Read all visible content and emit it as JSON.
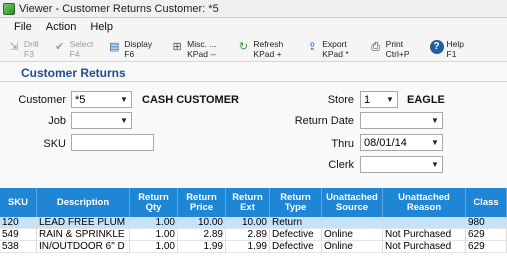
{
  "window": {
    "title": "Viewer - Customer Returns  Customer: *5"
  },
  "menu": [
    "File",
    "Action",
    "Help"
  ],
  "toolbar": [
    {
      "line1": "Drill",
      "line2": "F3",
      "icon": "drill-icon",
      "glyph": "⇲",
      "color": "#9a9a9a",
      "disabled": true
    },
    {
      "line1": "Select",
      "line2": "F4",
      "icon": "checkmark-icon",
      "glyph": "✔",
      "color": "#9a9a9a",
      "disabled": true
    },
    {
      "line1": "Display",
      "line2": "F6",
      "icon": "display-icon",
      "glyph": "▤",
      "color": "#1f5fa8",
      "disabled": false
    },
    {
      "line1": "Misc. ...",
      "line2": "KPad --",
      "icon": "misc-icon",
      "glyph": "⊞",
      "color": "#555555",
      "disabled": false
    },
    {
      "line1": "Refresh",
      "line2": "KPad +",
      "icon": "refresh-icon",
      "glyph": "↻",
      "color": "#2e9a3a",
      "disabled": false
    },
    {
      "line1": "Export",
      "line2": "KPad *",
      "icon": "export-icon",
      "glyph": "⇪",
      "color": "#1f5fa8",
      "disabled": false
    },
    {
      "line1": "Print",
      "line2": "Ctrl+P",
      "icon": "printer-icon",
      "glyph": "⎙",
      "color": "#333333",
      "disabled": false
    },
    {
      "line1": "Help",
      "line2": "F1",
      "icon": "help-icon",
      "glyph": "?",
      "color": "#ffffff",
      "disabled": false
    }
  ],
  "section_title": "Customer Returns",
  "form": {
    "customer_label": "Customer",
    "customer_value": "*5",
    "customer_name": "CASH CUSTOMER",
    "job_label": "Job",
    "job_value": "",
    "sku_label": "SKU",
    "sku_value": "",
    "store_label": "Store",
    "store_value": "1",
    "store_name": "EAGLE",
    "return_date_label": "Return Date",
    "return_date_value": "",
    "thru_label": "Thru",
    "thru_value": "08/01/14",
    "clerk_label": "Clerk",
    "clerk_value": ""
  },
  "table": {
    "columns": [
      "SKU",
      "Description",
      "Return Qty",
      "Return Price",
      "Return Ext",
      "Return Type",
      "Unattached Source",
      "Unattached Reason",
      "Class"
    ],
    "rows": [
      [
        "120",
        "LEAD FREE PLUM",
        "1.00",
        "10.00",
        "10.00",
        "Return",
        "",
        "",
        "980"
      ],
      [
        "549",
        "RAIN & SPRINKLE",
        "1.00",
        "2.89",
        "2.89",
        "Defective",
        "Online",
        "Not Purchased",
        "629"
      ],
      [
        "538",
        "IN/OUTDOOR 6\" D",
        "1.00",
        "1.99",
        "1.99",
        "Defective",
        "Online",
        "Not Purchased",
        "629"
      ]
    ]
  },
  "colors": {
    "accent": "#1f86d6",
    "selected_row": "#c6e2f8",
    "section_title": "#1f4e8c"
  }
}
